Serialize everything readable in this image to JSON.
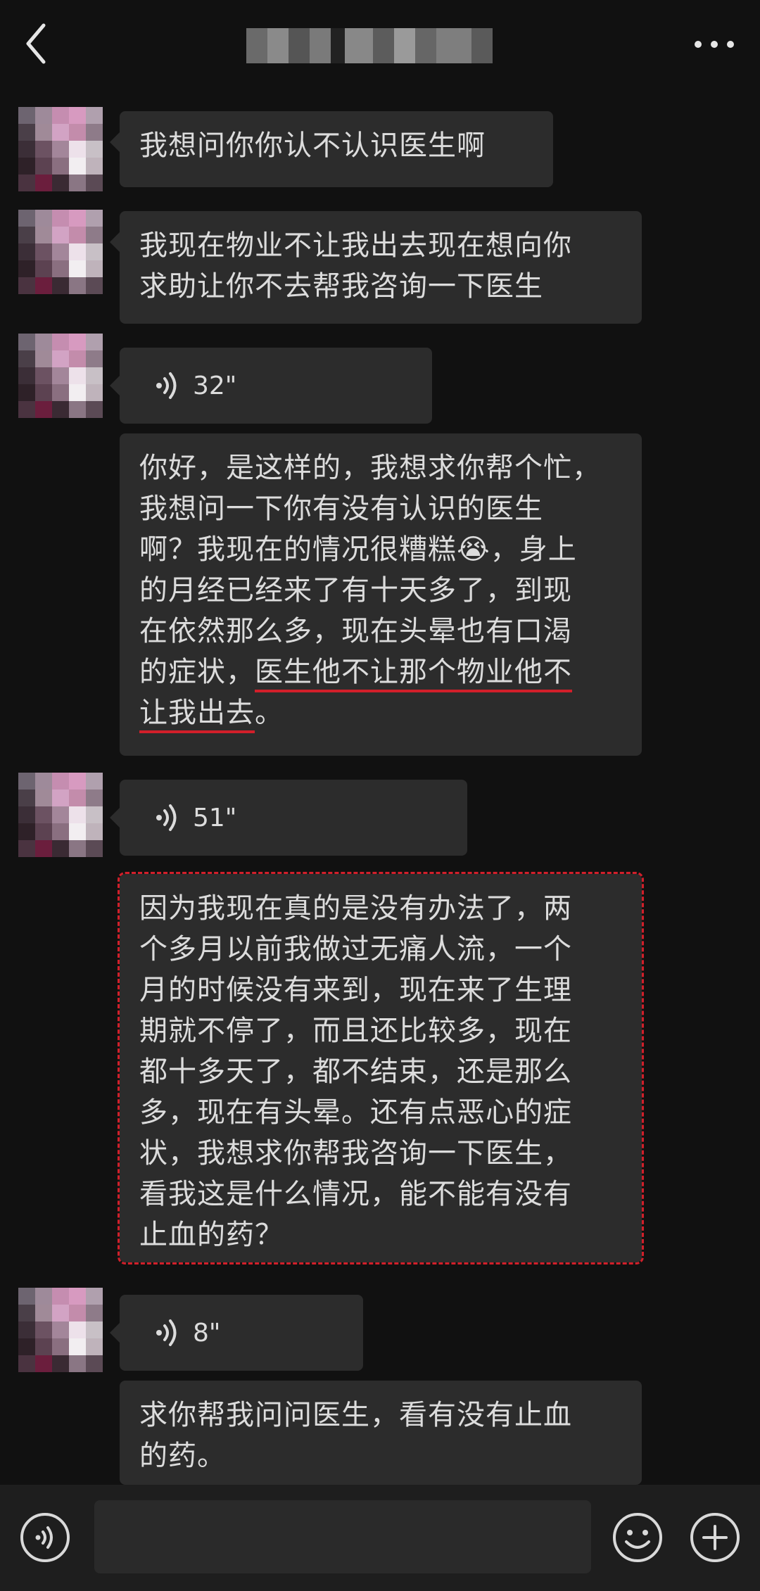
{
  "header": {
    "back_icon": "chevron-left-icon",
    "title_blurred": "",
    "more_icon": "more-horizontal-icon"
  },
  "messages": [
    {
      "type": "text",
      "text": "我想问你你认不认识医生啊"
    },
    {
      "type": "text",
      "lines": [
        "我现在物业不让我出去现在想向你",
        "求助让你不去帮我咨询一下医生"
      ]
    },
    {
      "type": "voice",
      "duration": "32\""
    },
    {
      "type": "text",
      "lines": [
        "你好，是这样的，我想求你帮个忙，",
        "我想问一下你有没有认识的医生",
        "啊？我现在的情况很糟糕",
        "，身上",
        "的月经已经来了有十天多了，到现",
        "在依然那么多，现在头晕也有口渴",
        "的症状，",
        "医生他不让那个物业他不",
        "让我出去",
        "。"
      ],
      "emoji": "😭"
    },
    {
      "type": "voice",
      "duration": "51\""
    },
    {
      "type": "text",
      "lines": [
        "因为我现在真的是没有办法了，两",
        "个多月以前我做过无痛人流，一个",
        "月的时候没有来到，现在来了生理",
        "期就不停了，而且还比较多，现在",
        "都十多天了，都不结束，还是那么",
        "多，现在有头晕。还有点恶心的症",
        "状，我想求你帮我咨询一下医生，",
        "看我这是什么情况，能不能有没有",
        "止血的药？"
      ]
    },
    {
      "type": "voice",
      "duration": "8\""
    },
    {
      "type": "text",
      "lines": [
        "求你帮我问问医生，看有没有止血",
        "的药。"
      ]
    }
  ],
  "bottom_bar": {
    "voice_icon": "voice-input-icon",
    "emoji_icon": "emoji-icon",
    "plus_icon": "plus-icon"
  },
  "colors": {
    "background": "#111111",
    "bubble": "#2c2c2c",
    "annotation_red": "#d21f2a"
  }
}
